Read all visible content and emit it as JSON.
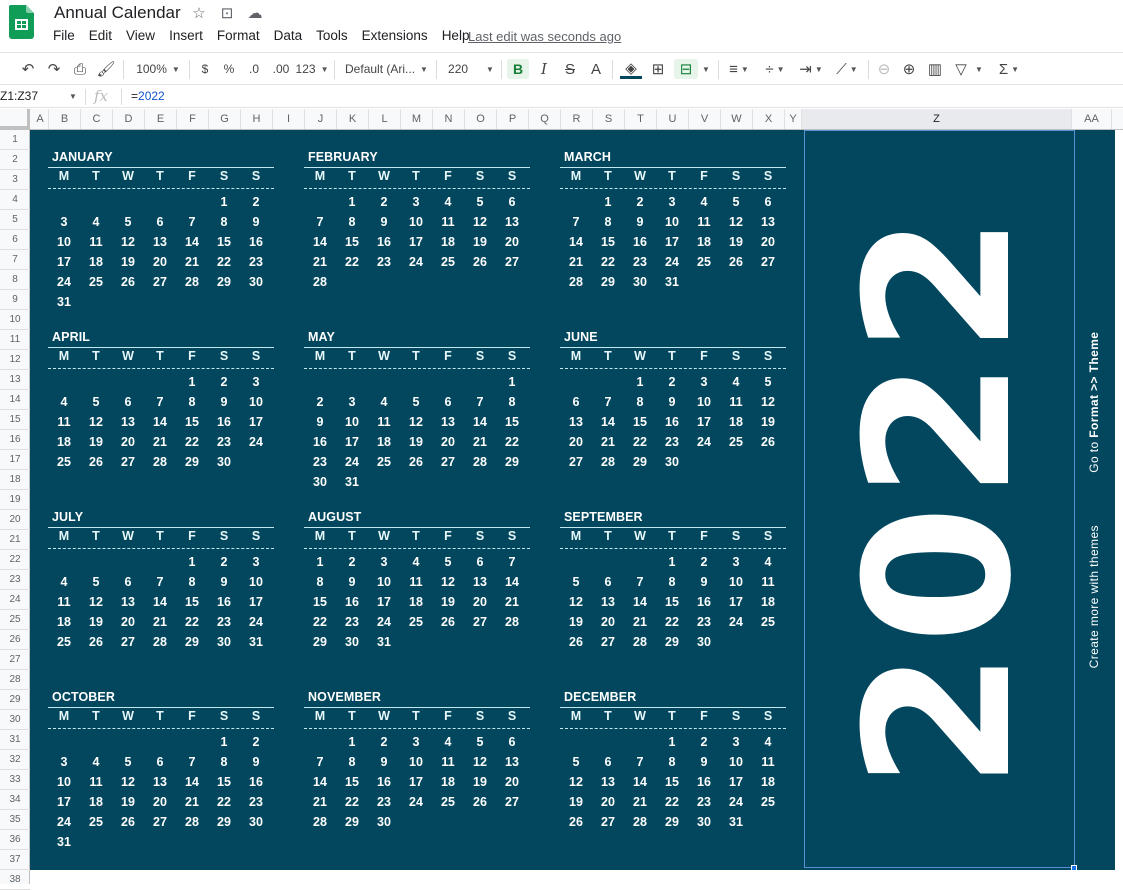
{
  "app": {
    "title": "Annual Calendar",
    "last_edit": "Last edit was seconds ago",
    "menus": [
      "File",
      "Edit",
      "View",
      "Insert",
      "Format",
      "Data",
      "Tools",
      "Extensions",
      "Help"
    ],
    "title_icons": [
      "star-icon",
      "move-to-folder-icon",
      "cloud-status-icon"
    ]
  },
  "toolbar": {
    "zoom": "100%",
    "currency": "$",
    "percent": "%",
    "decrease_decimal": ".0",
    "increase_decimal": ".00",
    "more_formats": "123",
    "font": "Default (Ari...",
    "font_size": "220",
    "bold": "B",
    "italic": "I",
    "strikethrough": "S",
    "text_color": "A",
    "sum": "Σ"
  },
  "formula_bar": {
    "name_box": "Z1:Z37",
    "fx": "fx",
    "formula_prefix": "=",
    "formula_value": "2022"
  },
  "columns": [
    "A",
    "B",
    "C",
    "D",
    "E",
    "F",
    "G",
    "H",
    "I",
    "J",
    "K",
    "L",
    "M",
    "N",
    "O",
    "P",
    "Q",
    "R",
    "S",
    "T",
    "U",
    "V",
    "W",
    "X",
    "Y",
    "Z",
    "AA"
  ],
  "selected_column": "Z",
  "rows": 38,
  "colors": {
    "sheet_bg": "#02475e",
    "text": "#ffffff",
    "rule": "#bfe9ef",
    "selection": "#1a73e8",
    "sheets_green": "#0f9d58"
  },
  "calendar": {
    "year": "2022",
    "weekdays": [
      "M",
      "T",
      "W",
      "T",
      "F",
      "S",
      "S"
    ],
    "months": [
      {
        "name": "JANUARY",
        "offset": 5,
        "days": 31
      },
      {
        "name": "FEBRUARY",
        "offset": 1,
        "days": 28
      },
      {
        "name": "MARCH",
        "offset": 1,
        "days": 31
      },
      {
        "name": "APRIL",
        "offset": 4,
        "days": 30
      },
      {
        "name": "MAY",
        "offset": 6,
        "days": 31
      },
      {
        "name": "JUNE",
        "offset": 2,
        "days": 30
      },
      {
        "name": "JULY",
        "offset": 4,
        "days": 31
      },
      {
        "name": "AUGUST",
        "offset": 0,
        "days": 31
      },
      {
        "name": "SEPTEMBER",
        "offset": 3,
        "days": 30
      },
      {
        "name": "OCTOBER",
        "offset": 5,
        "days": 31
      },
      {
        "name": "NOVEMBER",
        "offset": 1,
        "days": 30
      },
      {
        "name": "DECEMBER",
        "offset": 3,
        "days": 31
      }
    ]
  },
  "side_note": {
    "prefix": "Create more with themes",
    "go_to": "Go to",
    "path": "Format >> Theme"
  }
}
